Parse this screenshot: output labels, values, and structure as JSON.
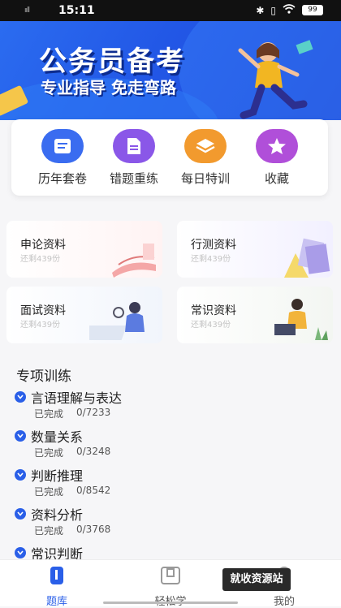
{
  "status_bar": {
    "signal": "ııll",
    "time": "15:11",
    "battery": "99"
  },
  "banner": {
    "title": "公务员备考",
    "subtitle": "专业指导 免走弯路"
  },
  "categories": [
    {
      "label": "历年套卷",
      "icon": "scroll-icon",
      "color": "#3a6cf0"
    },
    {
      "label": "错题重练",
      "icon": "document-icon",
      "color": "#8a57e8"
    },
    {
      "label": "每日特训",
      "icon": "layers-icon",
      "color": "#f29a2e"
    },
    {
      "label": "收藏",
      "icon": "star-icon",
      "color": "#b04fd9"
    }
  ],
  "materials": [
    {
      "title": "申论资料",
      "count": "还剩439份"
    },
    {
      "title": "行测资料",
      "count": "还剩439份"
    },
    {
      "title": "面试资料",
      "count": "还剩439份"
    },
    {
      "title": "常识资料",
      "count": "还剩439份"
    }
  ],
  "special_training": {
    "title": "专项训练",
    "items": [
      {
        "name": "言语理解与表达",
        "done_label": "已完成",
        "progress": "0/7233"
      },
      {
        "name": "数量关系",
        "done_label": "已完成",
        "progress": "0/3248"
      },
      {
        "name": "判断推理",
        "done_label": "已完成",
        "progress": "0/8542"
      },
      {
        "name": "资料分析",
        "done_label": "已完成",
        "progress": "0/3768"
      },
      {
        "name": "常识判断"
      }
    ]
  },
  "tabbar": {
    "tabs": [
      {
        "label": "题库",
        "active": true
      },
      {
        "label": "轻松学",
        "active": false
      },
      {
        "label": "我的",
        "active": false
      }
    ],
    "accent": "#2a5fe8"
  },
  "watermark": "就收资源站"
}
